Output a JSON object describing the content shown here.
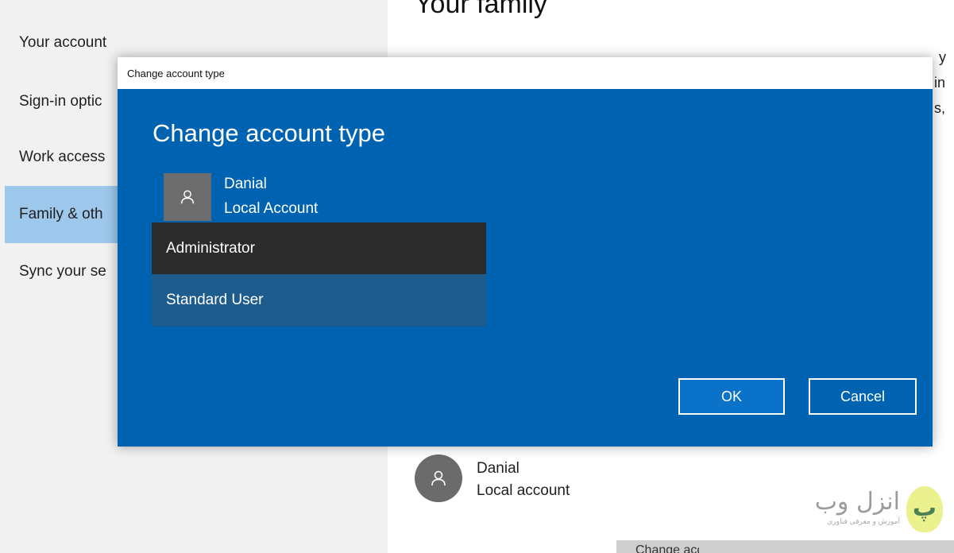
{
  "sidebar": {
    "items": [
      {
        "label": "Your account"
      },
      {
        "label": "Sign-in optic"
      },
      {
        "label": "Work access"
      },
      {
        "label": "Family & oth"
      },
      {
        "label": "Sync your se"
      }
    ],
    "selected_index": 3
  },
  "main": {
    "title": "Your family",
    "right_fragments": [
      "y",
      "in",
      "s,"
    ],
    "user": {
      "name": "Danial",
      "type": "Local account"
    },
    "bottom_text": "Change account type"
  },
  "dialog": {
    "window_title": "Change account type",
    "heading": "Change account type",
    "user": {
      "name": "Danial",
      "type": "Local Account"
    },
    "options": [
      {
        "label": "Administrator",
        "selected": true
      },
      {
        "label": "Standard User",
        "selected": false
      }
    ],
    "ok_label": "OK",
    "cancel_label": "Cancel"
  },
  "watermark": {
    "title": "انزل وب",
    "subtitle": "آموزش و معرفی فناوری"
  },
  "colors": {
    "dialog_bg": "#0063b1",
    "sidebar_bg": "#f1f1f1",
    "sidebar_selected": "#9ec7ec",
    "dropdown_selected": "#2b2b2b",
    "dropdown_bg": "#1e5585"
  }
}
